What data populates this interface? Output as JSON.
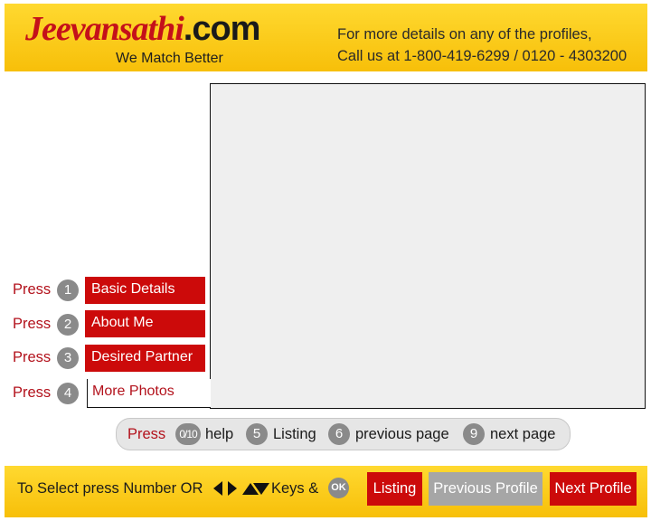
{
  "header": {
    "logo_name": "Jeevansathi",
    "logo_domain": ".com",
    "tagline": "We Match Better",
    "info_line1": "For more details on any of the profiles,",
    "info_line2": "Call us at 1-800-419-6299 / 0120 - 4303200"
  },
  "menu": {
    "press_label": "Press",
    "items": [
      {
        "number": "1",
        "label": "Basic Details"
      },
      {
        "number": "2",
        "label": "About Me"
      },
      {
        "number": "3",
        "label": "Desired Partner"
      },
      {
        "number": "4",
        "label": "More Photos"
      }
    ]
  },
  "help_bar": {
    "press_label": "Press",
    "help_key": "0/10",
    "help_label": "help",
    "listing_key": "5",
    "listing_label": "Listing",
    "prev_key": "6",
    "prev_label": "previous page",
    "next_key": "9",
    "next_label": "next page"
  },
  "footer": {
    "instruction_prefix": "To Select press Number OR",
    "instruction_keys": "Keys &",
    "ok_label": "OK",
    "listing_button": "Listing",
    "previous_button": "Previous Profile",
    "next_button": "Next Profile"
  },
  "colors": {
    "brand_red": "#cc0a0a",
    "header_yellow": "#f7bf09",
    "disabled_gray": "#a6a6a6"
  }
}
